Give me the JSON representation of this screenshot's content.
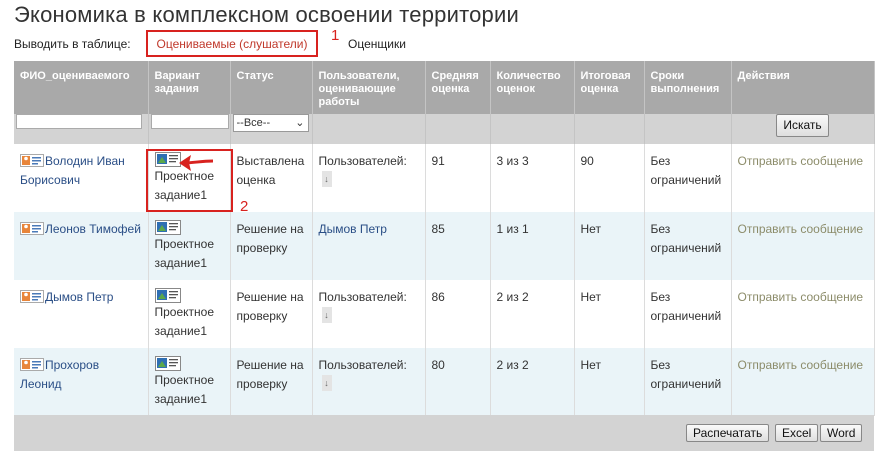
{
  "page": {
    "title": "Экономика в комплексном освоении территории",
    "show_label": "Выводить в таблице:",
    "tabs": [
      "Оцениваемые (слушатели)",
      "Оценщики"
    ],
    "annotations": [
      "1",
      "2"
    ]
  },
  "table": {
    "headers": [
      "ФИО_оцениваемого",
      "Вариант задания",
      "Статус",
      "Пользователи, оценивающие работы",
      "Средняя оценка",
      "Количество оценок",
      "Итоговая оценка",
      "Сроки выполнения",
      "Действия"
    ],
    "filter": {
      "select_value": "--Все--",
      "search_button": "Искать"
    },
    "rows": [
      {
        "name": "Володин Иван Борисович",
        "task": "Проектное задание1",
        "status": "Выставлена оценка",
        "users": "Пользователей:",
        "avg": "91",
        "count": "3 из 3",
        "final": "90",
        "deadline": "Без ограничений",
        "action": "Отправить сообщение"
      },
      {
        "name": "Леонов Тимофей",
        "task": "Проектное задание1",
        "status": "Решение на проверку",
        "users": "Дымов Петр",
        "avg": "85",
        "count": "1 из 1",
        "final": "Нет",
        "deadline": "Без ограничений",
        "action": "Отправить сообщение"
      },
      {
        "name": "Дымов Петр",
        "task": "Проектное задание1",
        "status": "Решение на проверку",
        "users": "Пользователей:",
        "avg": "86",
        "count": "2 из 2",
        "final": "Нет",
        "deadline": "Без ограничений",
        "action": "Отправить сообщение"
      },
      {
        "name": "Прохоров Леонид",
        "task": "Проектное задание1",
        "status": "Решение на проверку",
        "users": "Пользователей:",
        "avg": "80",
        "count": "2 из 2",
        "final": "Нет",
        "deadline": "Без ограничений",
        "action": "Отправить сообщение"
      }
    ]
  },
  "footer": {
    "buttons": [
      "Распечатать",
      "Excel",
      "Word"
    ]
  },
  "colors": {
    "header_bg": "#a9a9a9",
    "accent_red": "#d8221f",
    "link": "#2a4e86",
    "row_alt": "#eaf4f8"
  },
  "icons": {
    "person": "person-card-icon",
    "task": "task-doc-icon",
    "expand": "expand-arrow-icon"
  }
}
